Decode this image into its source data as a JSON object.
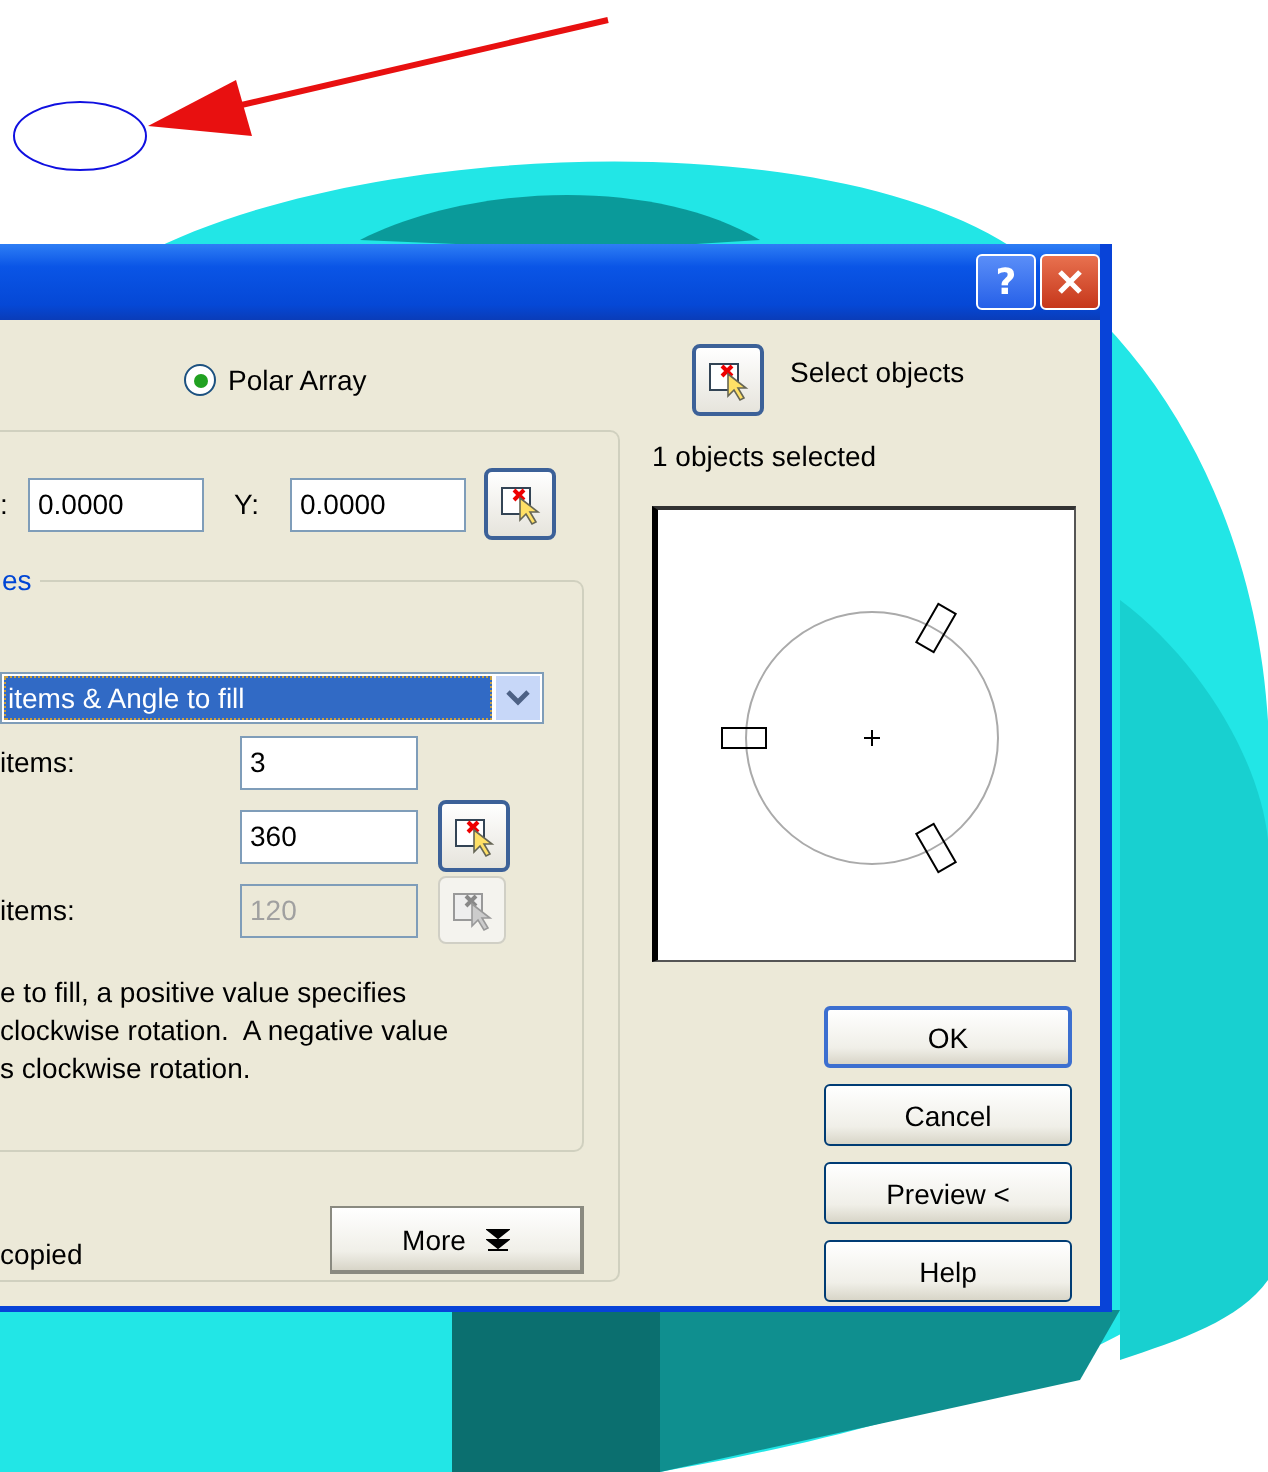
{
  "title_bar": {
    "help_glyph": "?"
  },
  "array_type": {
    "label": "Polar Array",
    "selected": true
  },
  "center_point": {
    "x_label": ":",
    "x_value": "0.0000",
    "y_label": "Y:",
    "y_value": "0.0000"
  },
  "method_group": {
    "legend": "es",
    "method": "items & Angle to fill",
    "fields": [
      {
        "label": "items:",
        "value": "3",
        "pick": false,
        "disabled": false
      },
      {
        "value": "360",
        "pick": true,
        "disabled": false
      },
      {
        "label": "items:",
        "value": "120",
        "pick": true,
        "disabled": true
      }
    ],
    "note": [
      "e to fill, a positive value specifies",
      "clockwise rotation.  A negative value",
      "s clockwise rotation."
    ]
  },
  "copy_option": {
    "label": "copied"
  },
  "more_button": {
    "label": "More"
  },
  "selection": {
    "label": "Select objects",
    "count": "1 objects selected"
  },
  "buttons": [
    {
      "label": "OK",
      "default": true
    },
    {
      "label": "Cancel",
      "default": false
    },
    {
      "label": "Preview <",
      "default": false
    },
    {
      "label": "Help",
      "default": false
    }
  ]
}
